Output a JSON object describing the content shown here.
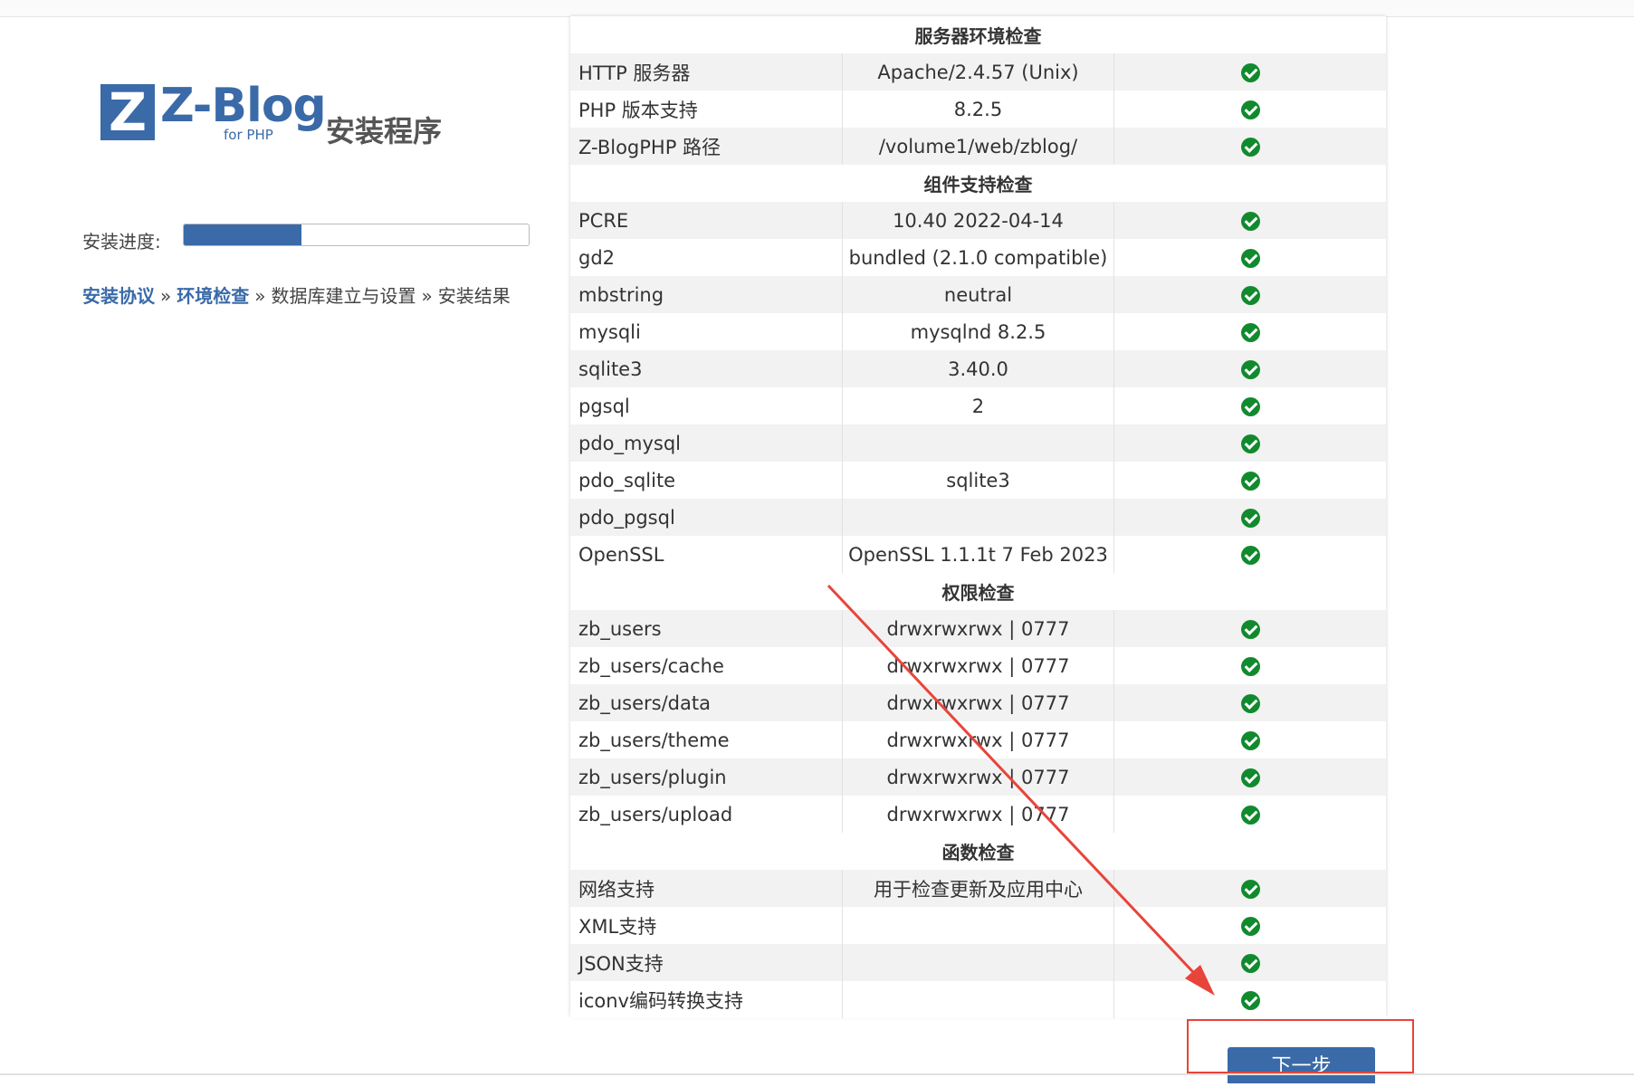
{
  "logo": {
    "letter": "Z",
    "word": "Z-Blog",
    "sub": "for PHP"
  },
  "title": "安装程序",
  "progress": {
    "label": "安装进度:",
    "fraction": 0.34
  },
  "steps": [
    {
      "label": "安装协议",
      "done": true
    },
    {
      "label": "环境检查",
      "done": true
    },
    {
      "label": "数据库建立与设置",
      "done": false
    },
    {
      "label": "安装结果",
      "done": false
    }
  ],
  "step_separator": "»",
  "sections": [
    {
      "title": "服务器环境检查",
      "rows": [
        {
          "name": "HTTP 服务器",
          "value": "Apache/2.4.57 (Unix)",
          "status": "ok"
        },
        {
          "name": "PHP 版本支持",
          "value": "8.2.5",
          "status": "ok"
        },
        {
          "name": "Z-BlogPHP 路径",
          "value": "/volume1/web/zblog/",
          "status": "ok"
        }
      ]
    },
    {
      "title": "组件支持检查",
      "rows": [
        {
          "name": "PCRE",
          "value": "10.40 2022-04-14",
          "status": "ok"
        },
        {
          "name": "gd2",
          "value": "bundled (2.1.0 compatible)",
          "status": "ok"
        },
        {
          "name": "mbstring",
          "value": "neutral",
          "status": "ok"
        },
        {
          "name": "mysqli",
          "value": "mysqlnd 8.2.5",
          "status": "ok"
        },
        {
          "name": "sqlite3",
          "value": "3.40.0",
          "status": "ok"
        },
        {
          "name": "pgsql",
          "value": "2",
          "status": "ok"
        },
        {
          "name": "pdo_mysql",
          "value": "",
          "status": "ok"
        },
        {
          "name": "pdo_sqlite",
          "value": "sqlite3",
          "status": "ok"
        },
        {
          "name": "pdo_pgsql",
          "value": "",
          "status": "ok"
        },
        {
          "name": "OpenSSL",
          "value": "OpenSSL 1.1.1t 7 Feb 2023",
          "status": "ok"
        }
      ]
    },
    {
      "title": "权限检查",
      "rows": [
        {
          "name": "zb_users",
          "value": "drwxrwxrwx | 0777",
          "status": "ok"
        },
        {
          "name": "zb_users/cache",
          "value": "drwxrwxrwx | 0777",
          "status": "ok"
        },
        {
          "name": "zb_users/data",
          "value": "drwxrwxrwx | 0777",
          "status": "ok"
        },
        {
          "name": "zb_users/theme",
          "value": "drwxrwxrwx | 0777",
          "status": "ok"
        },
        {
          "name": "zb_users/plugin",
          "value": "drwxrwxrwx | 0777",
          "status": "ok"
        },
        {
          "name": "zb_users/upload",
          "value": "drwxrwxrwx | 0777",
          "status": "ok"
        }
      ]
    },
    {
      "title": "函数检查",
      "rows": [
        {
          "name": "网络支持",
          "value": "用于检查更新及应用中心",
          "status": "ok"
        },
        {
          "name": "XML支持",
          "value": "",
          "status": "ok"
        },
        {
          "name": "JSON支持",
          "value": "",
          "status": "ok"
        },
        {
          "name": "iconv编码转换支持",
          "value": "",
          "status": "ok"
        }
      ]
    }
  ],
  "next_button": {
    "label": "下一步"
  },
  "status_icon": "check-circle-icon",
  "colors": {
    "brand": "#3a6aa8",
    "ok": "#118a2e",
    "annotation": "#e8443a"
  }
}
